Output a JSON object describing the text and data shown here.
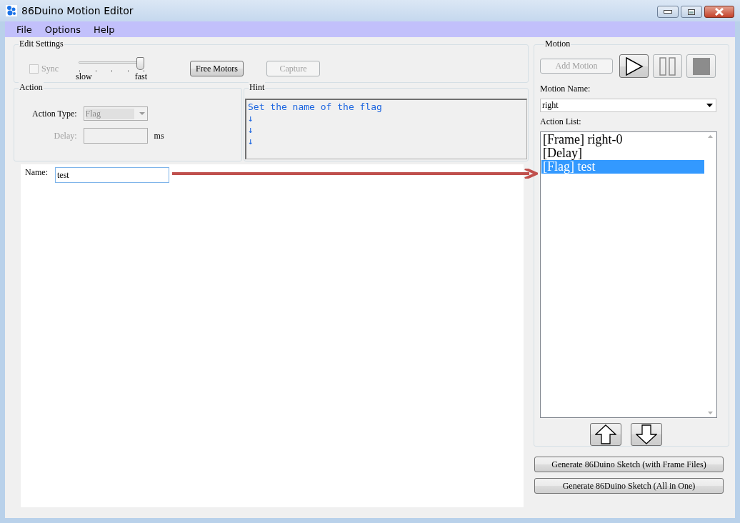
{
  "window": {
    "title": "86Duino Motion Editor"
  },
  "menu": [
    {
      "label": "File"
    },
    {
      "label": "Options"
    },
    {
      "label": "Help"
    }
  ],
  "edit_settings": {
    "title": "Edit Settings",
    "sync": {
      "label": "Sync",
      "checked": false,
      "disabled": true
    },
    "speed": {
      "level": 1,
      "min_label": "slow",
      "max_label": "fast"
    },
    "buttons": [
      {
        "label": "Free Motors",
        "disabled": false
      },
      {
        "label": "Capture",
        "disabled": true
      }
    ]
  },
  "action": {
    "title": "Action",
    "action_type": {
      "label": "Action Type:",
      "value": "Flag",
      "disabled": true
    },
    "delay": {
      "label": "Delay:",
      "unit": "ms",
      "disabled": true
    }
  },
  "hint": {
    "title": "Hint",
    "lines": [
      "Set the name of the flag",
      "↓",
      "↓",
      "↓"
    ]
  },
  "name_field": {
    "label": "Name:",
    "value": "test"
  },
  "motion": {
    "title": "Motion",
    "add_button": {
      "label": "Add Motion",
      "disabled": true
    },
    "media_buttons": [
      {
        "kind": "play",
        "disabled": false
      },
      {
        "kind": "pause",
        "disabled": true
      },
      {
        "kind": "stop",
        "disabled": true
      }
    ],
    "motion_name": {
      "label": "Motion Name:",
      "value": "right"
    },
    "action_list": {
      "label": "Action List:",
      "items": [
        {
          "text": "[Frame] right-0",
          "selected": false
        },
        {
          "text": "[Delay]",
          "selected": false
        },
        {
          "text": "[Flag] test",
          "selected": true
        }
      ]
    },
    "move_buttons": [
      {
        "kind": "up"
      },
      {
        "kind": "down"
      }
    ]
  },
  "generate_buttons": [
    {
      "label": "Generate 86Duino Sketch (with Frame Files)"
    },
    {
      "label": "Generate 86Duino Sketch (All in One)"
    }
  ]
}
